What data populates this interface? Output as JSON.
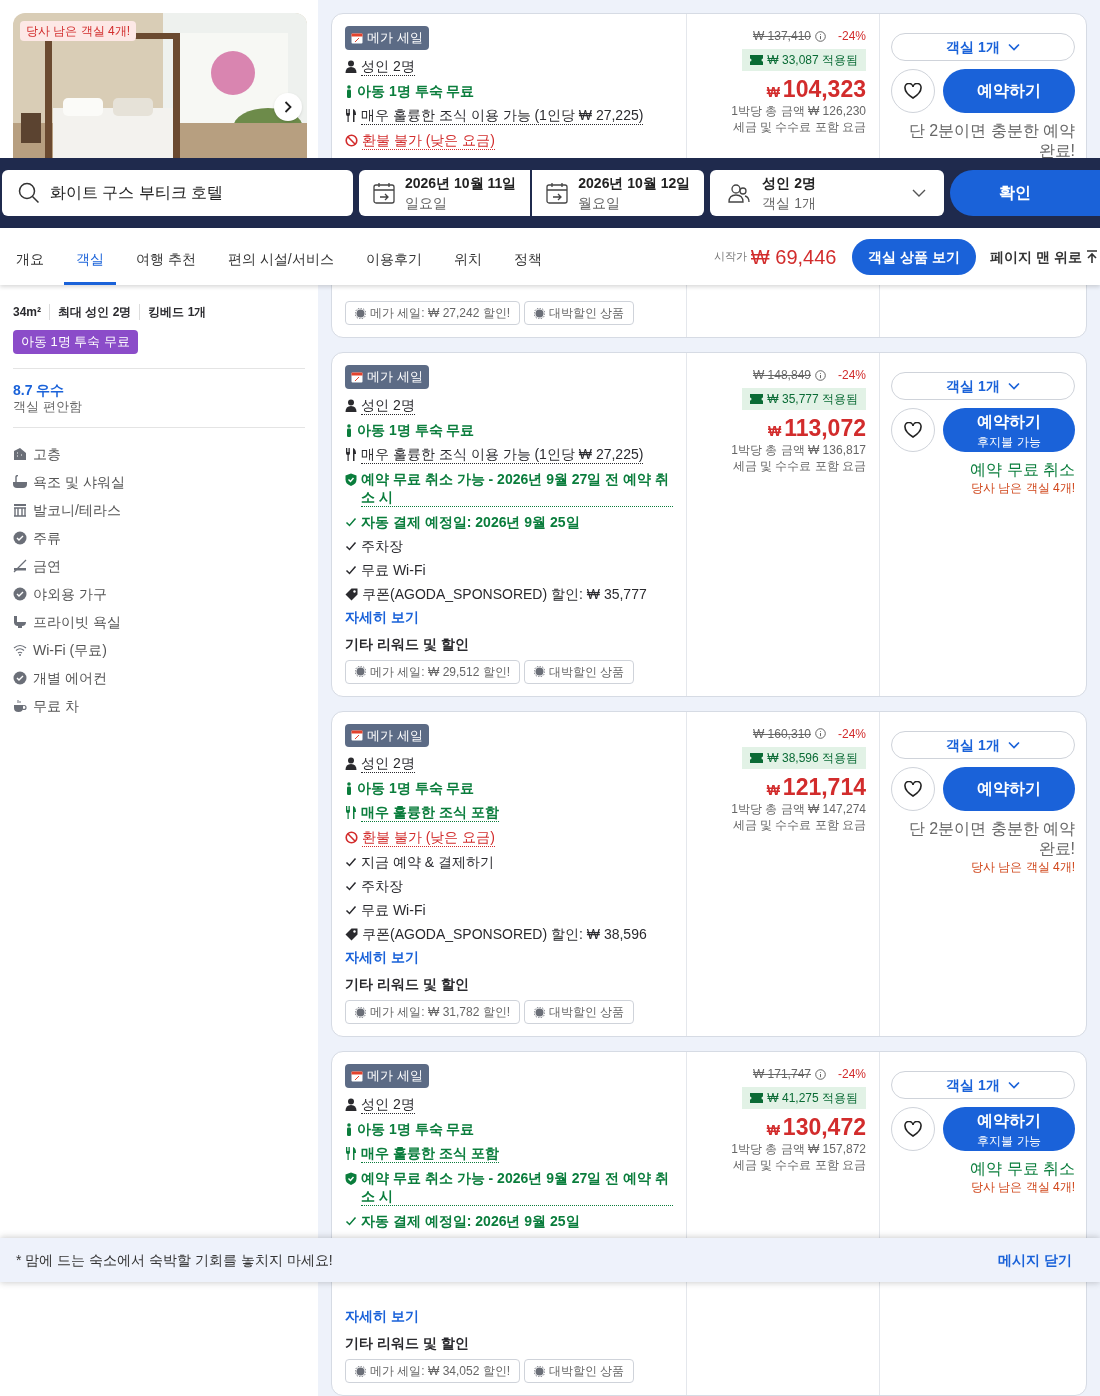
{
  "room_panel": {
    "photo": {
      "kind": "picture"
    },
    "photo_badge": "당사 남은 객실 4개!",
    "specs": [
      "34m²",
      "최대 성인 2명",
      "킹베드 1개"
    ],
    "child_badge": "아동 1명 투숙 무료",
    "rating": {
      "score": "8.7 우수",
      "label": "객실 편안함"
    },
    "amenities": [
      {
        "kind": "building",
        "label": "고층"
      },
      {
        "kind": "bath",
        "label": "욕조 및 샤워실"
      },
      {
        "kind": "balcony",
        "label": "발코니/테라스"
      },
      {
        "kind": "check",
        "label": "주류"
      },
      {
        "kind": "nosmoking",
        "label": "금연"
      },
      {
        "kind": "check",
        "label": "야외용 가구"
      },
      {
        "kind": "toilet",
        "label": "프라이빗 욕실"
      },
      {
        "kind": "wifi",
        "label": "Wi-Fi (무료)"
      },
      {
        "kind": "check",
        "label": "개별 에어컨"
      },
      {
        "kind": "tea",
        "label": "무료 차"
      }
    ]
  },
  "offers": [
    {
      "tag": "메가 세일",
      "features": [
        {
          "kind": "guests",
          "text": "성인 2명"
        },
        {
          "kind": "child",
          "text": "아동 1명 투숙 무료"
        },
        {
          "kind": "meal",
          "text": "매우 훌륭한 조식 이용 가능 (1인당 ₩ 27,225)"
        },
        {
          "kind": "nonrefundable",
          "text": "환불 불가 (낮은 요금)"
        }
      ],
      "rewards": [
        "메가 세일: ₩ 27,242 할인!",
        "대박할인 상품"
      ],
      "original_price": "₩ 137,410",
      "discount": "-24%",
      "coupon": "₩ 33,087 적용됨",
      "currency": "₩",
      "price": "104,323",
      "per_night": "1박당 총 금액 ₩ 126,230",
      "tax_note": "세금 및 수수료 포함 요금",
      "rooms": "객실 1개",
      "book": {
        "label": "예약하기"
      },
      "note": {
        "kind": "quick",
        "text": "단 2분이면 충분한 예약 완료!"
      }
    },
    {
      "tag": "메가 세일",
      "features": [
        {
          "kind": "guests",
          "text": "성인 2명"
        },
        {
          "kind": "child",
          "text": "아동 1명 투숙 무료"
        },
        {
          "kind": "meal",
          "text": "매우 훌륭한 조식 이용 가능 (1인당 ₩ 27,225)"
        },
        {
          "kind": "free_cancel",
          "text": "예약 무료 취소 가능 - 2026년 9월 27일 전 예약 취소 시"
        },
        {
          "kind": "autopay",
          "text": "자동 결제 예정일: 2026년 9월 25일"
        },
        {
          "kind": "check",
          "text": "주차장"
        },
        {
          "kind": "check",
          "text": "무료 Wi-Fi"
        },
        {
          "kind": "coupon",
          "text": "쿠폰(AGODA_SPONSORED) 할인: ₩ 35,777"
        }
      ],
      "details_link": "자세히 보기",
      "rewards_title": "기타 리워드 및 할인",
      "rewards": [
        "메가 세일: ₩ 29,512 할인!",
        "대박할인 상품"
      ],
      "original_price": "₩ 148,849",
      "discount": "-24%",
      "coupon": "₩ 35,777 적용됨",
      "currency": "₩",
      "price": "113,072",
      "per_night": "1박당 총 금액 ₩ 136,817",
      "tax_note": "세금 및 수수료 포함 요금",
      "rooms": "객실 1개",
      "book": {
        "label": "예약하기",
        "sub": "후지불 가능"
      },
      "note": {
        "kind": "free_cancel",
        "text": "예약 무료 취소"
      },
      "stock": "당사 남은 객실 4개!"
    },
    {
      "tag": "메가 세일",
      "features": [
        {
          "kind": "guests",
          "text": "성인 2명"
        },
        {
          "kind": "child",
          "text": "아동 1명 투숙 무료"
        },
        {
          "kind": "meal_included",
          "text": "매우 훌륭한 조식 포함"
        },
        {
          "kind": "nonrefundable",
          "text": "환불 불가 (낮은 요금)"
        },
        {
          "kind": "check",
          "text": "지금 예약 & 결제하기"
        },
        {
          "kind": "check",
          "text": "주차장"
        },
        {
          "kind": "check",
          "text": "무료 Wi-Fi"
        },
        {
          "kind": "coupon",
          "text": "쿠폰(AGODA_SPONSORED) 할인: ₩ 38,596"
        }
      ],
      "details_link": "자세히 보기",
      "rewards_title": "기타 리워드 및 할인",
      "rewards": [
        "메가 세일: ₩ 31,782 할인!",
        "대박할인 상품"
      ],
      "original_price": "₩ 160,310",
      "discount": "-24%",
      "coupon": "₩ 38,596 적용됨",
      "currency": "₩",
      "price": "121,714",
      "per_night": "1박당 총 금액 ₩ 147,274",
      "tax_note": "세금 및 수수료 포함 요금",
      "rooms": "객실 1개",
      "book": {
        "label": "예약하기"
      },
      "note": {
        "kind": "quick",
        "text": "단 2분이면 충분한 예약 완료!"
      },
      "stock": "당사 남은 객실 4개!"
    },
    {
      "tag": "메가 세일",
      "features": [
        {
          "kind": "guests",
          "text": "성인 2명"
        },
        {
          "kind": "child",
          "text": "아동 1명 투숙 무료"
        },
        {
          "kind": "meal_included",
          "text": "매우 훌륭한 조식 포함"
        },
        {
          "kind": "free_cancel",
          "text": "예약 무료 취소 가능 - 2026년 9월 27일 전 예약 취소 시"
        },
        {
          "kind": "autopay",
          "text": "자동 결제 예정일: 2026년 9월 25일"
        }
      ],
      "details_link": "자세히 보기",
      "rewards_title": "기타 리워드 및 할인",
      "rewards": [
        "메가 세일: ₩ 34,052 할인!",
        "대박할인 상품"
      ],
      "original_price": "₩ 171,747",
      "discount": "-24%",
      "coupon": "₩ 41,275 적용됨",
      "currency": "₩",
      "price": "130,472",
      "per_night": "1박당 총 금액 ₩ 157,872",
      "tax_note": "세금 및 수수료 포함 요금",
      "rooms": "객실 1개",
      "book": {
        "label": "예약하기",
        "sub": "후지불 가능"
      },
      "note": {
        "kind": "free_cancel",
        "text": "예약 무료 취소"
      },
      "stock": "당사 남은 객실 4개!"
    }
  ],
  "search_bar": {
    "query": "화이트 구스 부티크 호텔",
    "check_in": {
      "date": "2026년 10월 11일",
      "day": "일요일"
    },
    "check_out": {
      "date": "2026년 10월 12일",
      "day": "월요일"
    },
    "guests": {
      "adults": "성인 2명",
      "rooms": "객실 1개"
    },
    "confirm": "확인"
  },
  "nav": {
    "tabs": [
      {
        "label": "개요",
        "selected": false
      },
      {
        "label": "객실",
        "selected": true
      },
      {
        "label": "여행 추천",
        "selected": false
      },
      {
        "label": "편의 시설/서비스",
        "selected": false
      },
      {
        "label": "이용후기",
        "selected": false
      },
      {
        "label": "위치",
        "selected": false
      },
      {
        "label": "정책",
        "selected": false
      }
    ],
    "from_label": "시작가",
    "from_price": "₩ 69,446",
    "view_button": "객실 상품 보기",
    "top_link": "페이지 맨 위로"
  },
  "message_bar": {
    "text": "* 맘에 드는 숙소에서 숙박할 기회를 놓치지 마세요!",
    "close": "메시지 닫기"
  }
}
